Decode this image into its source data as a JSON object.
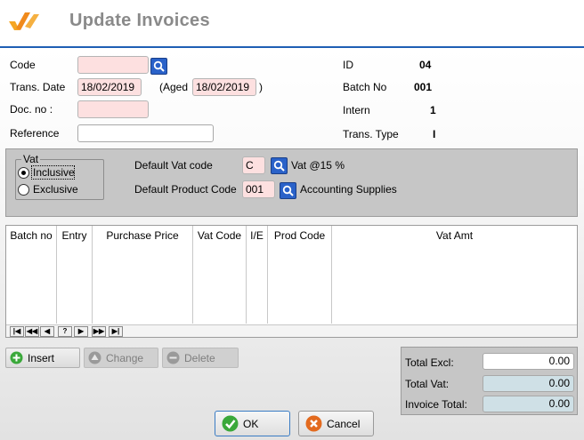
{
  "window": {
    "title": "Update Invoices"
  },
  "header": {
    "code_label": "Code",
    "code_value": "",
    "trans_date_label": "Trans. Date",
    "trans_date_value": "18/02/2019",
    "aged_label": "(Aged",
    "aged_value": "18/02/2019",
    "aged_close": ")",
    "doc_no_label": "Doc. no :",
    "doc_no_value": "",
    "reference_label": "Reference",
    "reference_value": "",
    "id_label": "ID",
    "id_value": "04",
    "batch_no_label": "Batch No",
    "batch_no_value": "001",
    "intern_label": "Intern",
    "intern_value": "1",
    "trans_type_label": "Trans. Type",
    "trans_type_value": "I"
  },
  "vat": {
    "group_title": "Vat",
    "inclusive_label": "Inclusive",
    "exclusive_label": "Exclusive",
    "selected": "Inclusive",
    "default_vat_code_label": "Default Vat code",
    "default_vat_code_value": "C",
    "vat_description": "Vat @15 %",
    "default_product_code_label": "Default Product Code",
    "default_product_code_value": "001",
    "product_description": "Accounting Supplies"
  },
  "grid": {
    "columns": [
      "Batch no",
      "Entry",
      "Purchase Price",
      "Vat Code",
      "I/E",
      "Prod Code",
      "Vat Amt"
    ],
    "rows": [],
    "nav": [
      "|◀",
      "◀◀",
      "◀",
      "?",
      "▶",
      "▶▶",
      "▶|"
    ]
  },
  "actions": {
    "insert_label": "Insert",
    "change_label": "Change",
    "delete_label": "Delete"
  },
  "totals": {
    "excl_label": "Total Excl:",
    "excl_value": "0.00",
    "vat_label": "Total Vat:",
    "vat_value": "0.00",
    "invoice_label": "Invoice Total:",
    "invoice_value": "0.00"
  },
  "buttons": {
    "ok_label": "OK",
    "cancel_label": "Cancel"
  },
  "colors": {
    "accent_blue": "#1e5fb4",
    "required_field": "#fde0e0",
    "panel_gray": "#c6c6c6",
    "ok_green": "#3aa83a",
    "cancel_orange": "#e36a1e"
  }
}
